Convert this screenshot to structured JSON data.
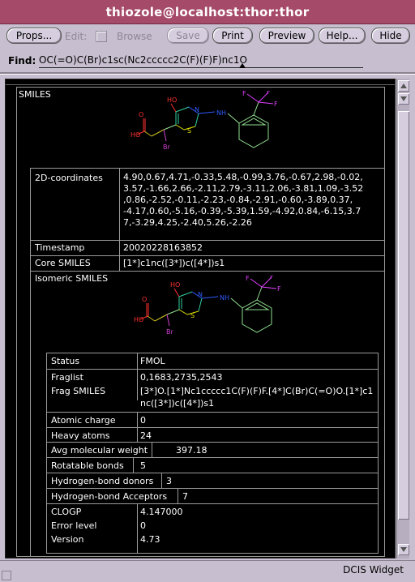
{
  "window": {
    "title": "thiozole@localhost:thor:thor"
  },
  "toolbar": {
    "props": "Props...",
    "edit": "Edit:",
    "browse": "Browse",
    "save": "Save",
    "print": "Print",
    "preview": "Preview",
    "help": "Help...",
    "hide": "Hide"
  },
  "find": {
    "label": "Find:",
    "value": "OC(=O)C(Br)c1sc(Nc2ccccc2C(F)(F)F)nc1O"
  },
  "record": {
    "smiles_label": "SMILES",
    "coords_label": "2D-coordinates",
    "coords_lines": [
      "4.90,0.67,4.71,-0.33,5.48,-0.99,3.76,-0.67,2.98,-0.02,",
      "3.57,-1.66,2.66,-2.11,2.79,-3.11,2.06,-3.81,1.09,-3.52",
      ",0.86,-2.52,-0.11,-2.23,-0.84,-2.91,-0.60,-3.89,0.37,",
      "-4.17,0.60,-5.16,-0.39,-5.39,1.59,-4.92,0.84,-6.15,3.7",
      "7,-3.29,4.25,-2.40,5.26,-2.26"
    ],
    "timestamp_label": "Timestamp",
    "timestamp_value": "20020228163852",
    "core_label": "Core SMILES",
    "core_value": "[1*]c1nc([3*])c([4*])s1",
    "isomeric_label": "Isomeric SMILES",
    "props": {
      "status_label": "Status",
      "status_value": "FMOL",
      "fraglist_label": "Fraglist",
      "fraglist_value": "0,1683,2735,2543",
      "fragsmiles_label": "Frag SMILES",
      "fragsmiles_line1": "[3*]O.[1*]Nc1ccccc1C(F)(F)F.[4*]C(Br)C(=O)O.[1*]c1",
      "fragsmiles_line2": "nc([3*])c([4*])s1",
      "charge_label": "Atomic charge",
      "charge_value": "0",
      "heavy_label": "Heavy atoms",
      "heavy_value": "24",
      "mw_label": "Avg molecular weight",
      "mw_value": "397.18",
      "rot_label": "Rotatable bonds",
      "rot_value": "5",
      "hbd_label": "Hydrogen-bond donors",
      "hbd_value": "3",
      "hba_label": "Hydrogen-bond Acceptors",
      "hba_value": "7",
      "clogp_label": "CLOGP",
      "clogp_value": "4.147000",
      "err_label": "Error level",
      "err_value": "0",
      "ver_label": "Version",
      "ver_value": "4.73"
    },
    "mol_atoms": {
      "O": "O",
      "OH": "OH",
      "HO": "HO",
      "Br": "Br",
      "N": "N",
      "NH": "NH",
      "S": "S",
      "F": "F"
    }
  },
  "status": {
    "text": "DCIS Widget"
  },
  "colors": {
    "titlebar": "#a64a6a",
    "background": "#c7bfcf",
    "pane": "#000000",
    "oxygen": "#ff3030",
    "nitrogen": "#2f5bff",
    "sulfur": "#e0e000",
    "bromine": "#d040d0",
    "fluorine": "#e040ff",
    "carbon_bond_a": "#30d0a0",
    "carbon_bond_b": "#d0c020",
    "carbon_bond_c": "#90e090"
  }
}
